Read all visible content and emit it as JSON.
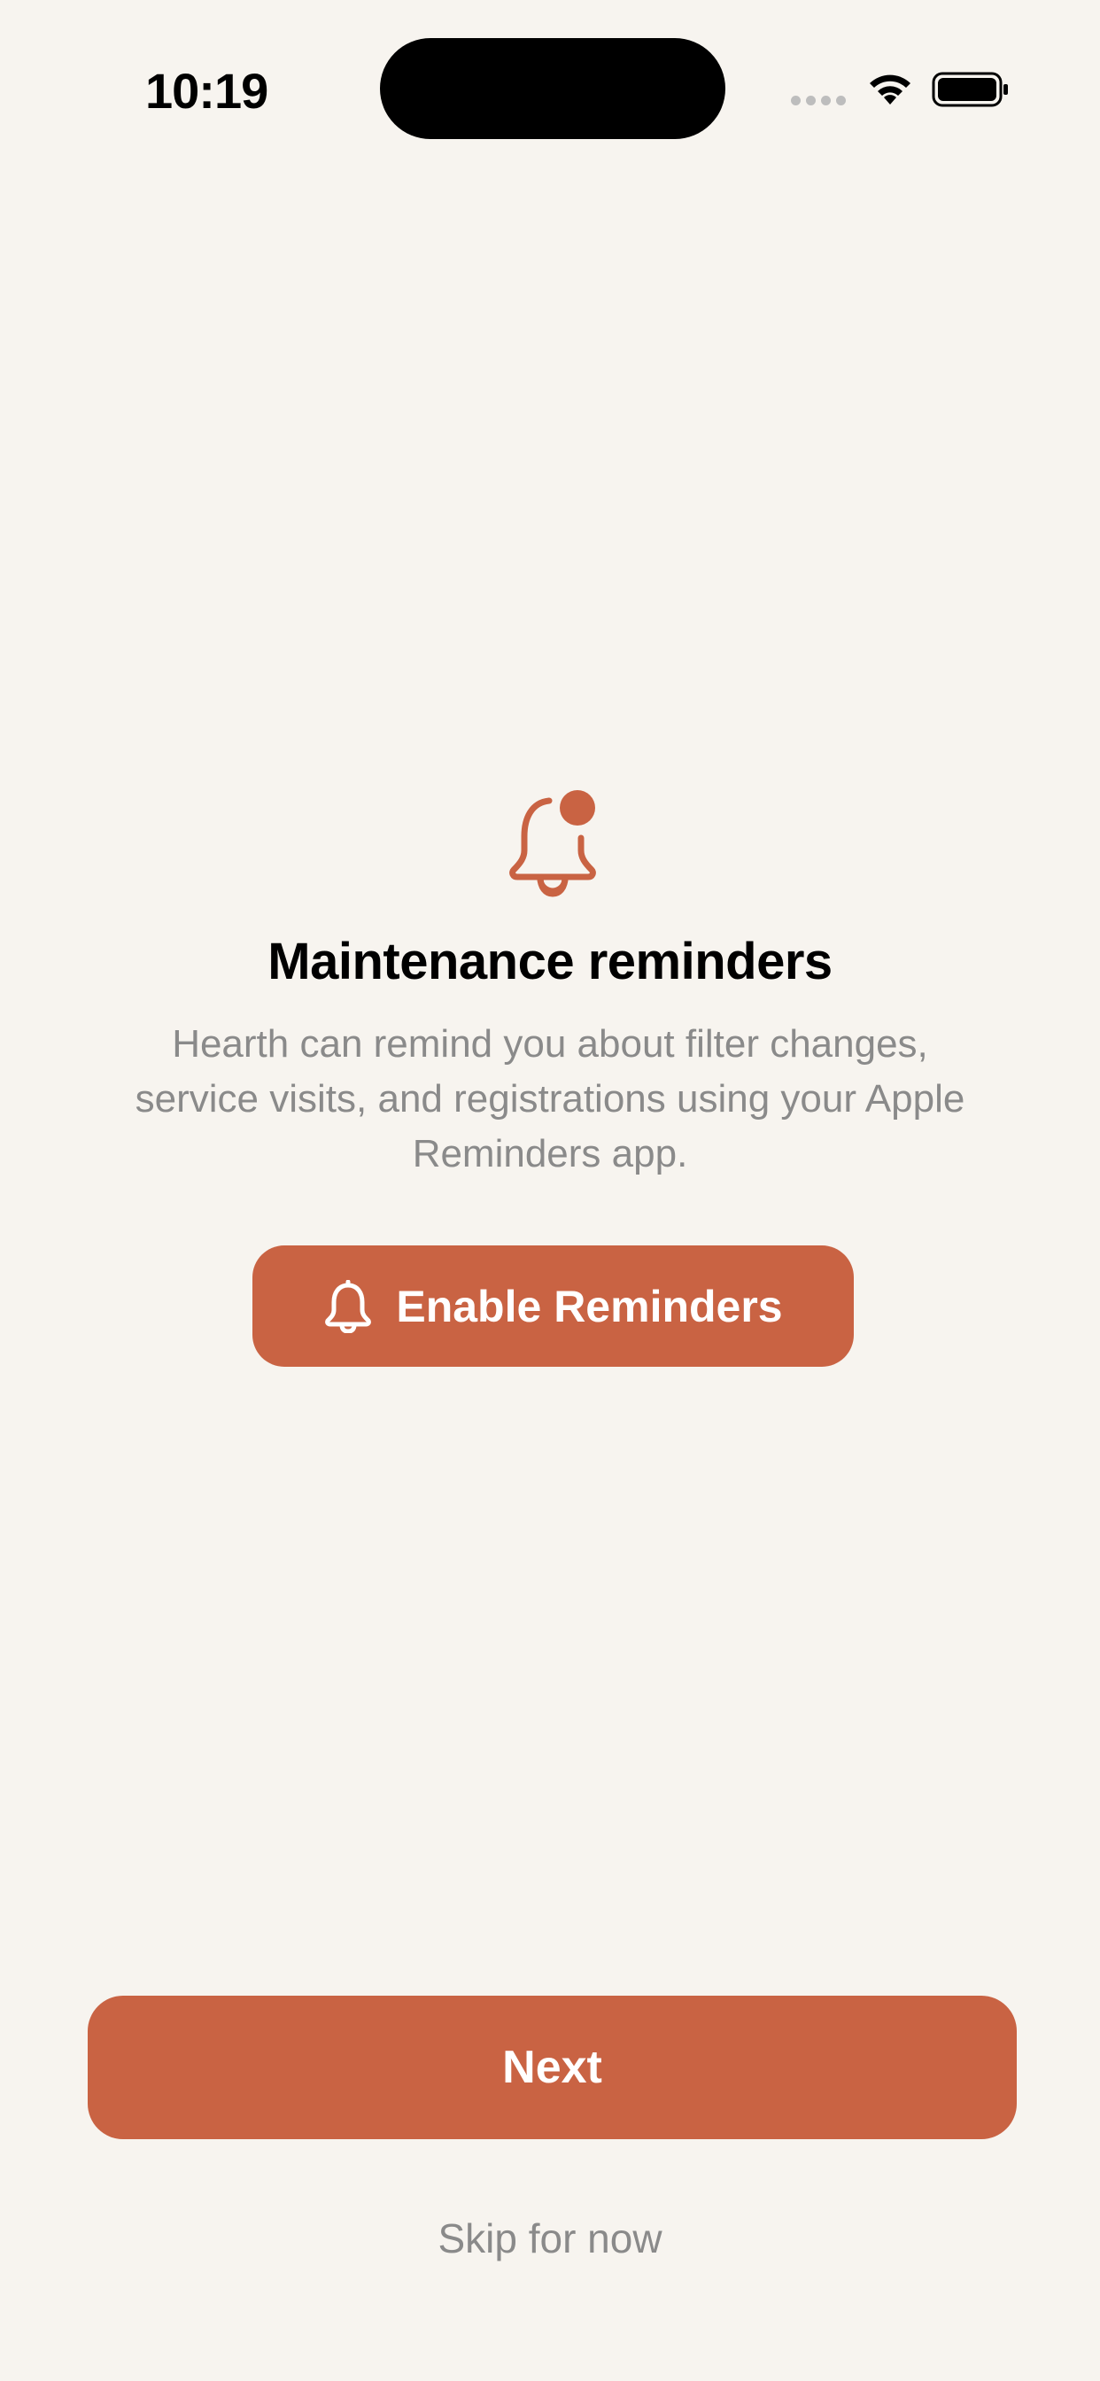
{
  "status_bar": {
    "time": "10:19",
    "icons": [
      "cellular-signal-icon",
      "wifi-icon",
      "battery-icon"
    ]
  },
  "onboarding": {
    "icon": "bell-badge-icon",
    "title": "Maintenance reminders",
    "description": "Hearth can remind you about filter changes, service visits, and registrations using your Apple Reminders app.",
    "enable_button": {
      "icon": "bell-icon",
      "label": "Enable Reminders"
    }
  },
  "footer": {
    "next_label": "Next",
    "skip_label": "Skip for now"
  },
  "colors": {
    "background": "#F7F4EF",
    "accent": "#C96343",
    "secondary_text": "#8A8A8A",
    "primary_text": "#000000"
  }
}
